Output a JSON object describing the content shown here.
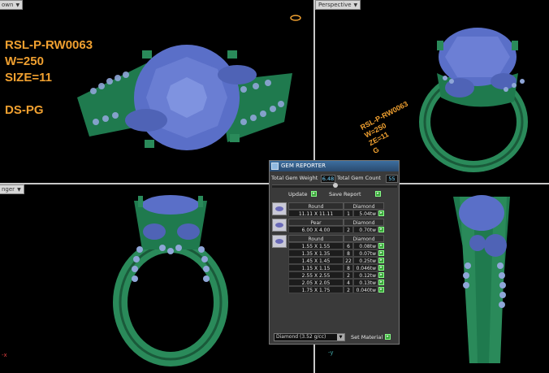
{
  "viewports": {
    "top_label": "own",
    "persp_label": "Perspective",
    "front_label": "nger",
    "side_label": ""
  },
  "ring_label": {
    "line1": "RSL-P-RW0063",
    "line2": "W=250",
    "line3": "SIZE=11",
    "line4": "DS-PG"
  },
  "persp_label_text": {
    "line1": "RSL-P-RW0063",
    "line2": "W=250",
    "line3": "ZE=11",
    "line4": "G"
  },
  "gem_reporter": {
    "title": "GEM REPORTER",
    "total_weight_label": "Total Gem Weight",
    "total_weight_value": "6.48",
    "total_count_label": "Total Gem Count",
    "total_count_value": "55",
    "update_label": "Update",
    "save_report_label": "Save Report",
    "groups": [
      {
        "shape": "Round",
        "material": "Diamond",
        "rows": [
          {
            "size": "11.11 X 11.11",
            "count": "1",
            "weight": "5.04tw"
          }
        ]
      },
      {
        "shape": "Pear",
        "material": "Diamond",
        "rows": [
          {
            "size": "6.00 X 4.00",
            "count": "2",
            "weight": "0.70tw"
          }
        ]
      },
      {
        "shape": "Round",
        "material": "Diamond",
        "rows": [
          {
            "size": "1.55 X 1.55",
            "count": "6",
            "weight": "0.08tw"
          },
          {
            "size": "1.35 X 1.35",
            "count": "8",
            "weight": "0.07tw"
          },
          {
            "size": "1.45 X 1.45",
            "count": "22",
            "weight": "0.25tw"
          },
          {
            "size": "1.15 X 1.15",
            "count": "8",
            "weight": "0.046tw"
          },
          {
            "size": "2.55 X 2.55",
            "count": "2",
            "weight": "0.12tw"
          },
          {
            "size": "2.05 X 2.05",
            "count": "4",
            "weight": "0.13tw"
          },
          {
            "size": "1.75 X 1.75",
            "count": "2",
            "weight": "0.040tw"
          }
        ]
      }
    ],
    "material_select": "Diamond   (3.52 g/cc)",
    "set_material_label": "Set Material"
  },
  "colors": {
    "metal": "#2a8a5a",
    "metal_dark": "#1a5a3a",
    "stone": "#5a6fc8",
    "label": "#f0a030"
  }
}
